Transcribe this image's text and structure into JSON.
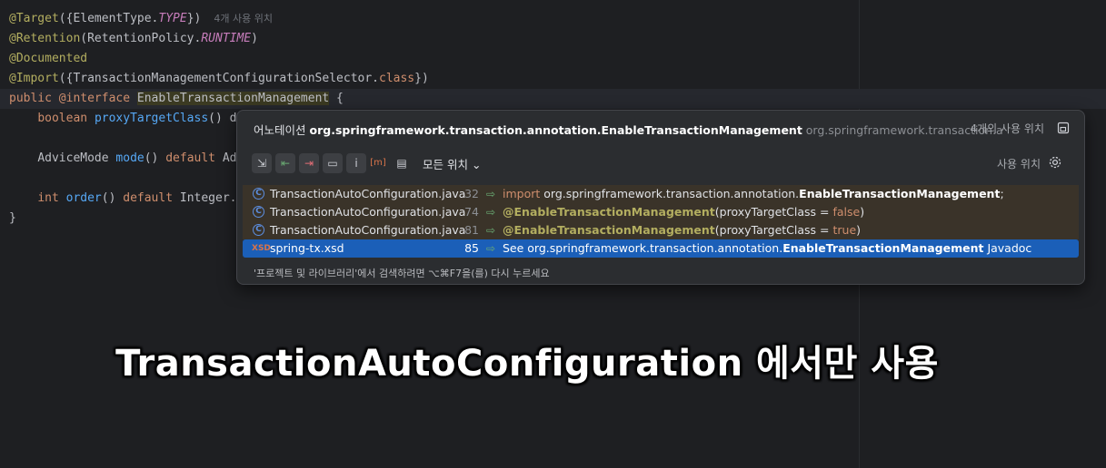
{
  "code": {
    "line1": {
      "anno": "@Target",
      "body": "({ElementType.",
      "const": "TYPE",
      "end": "})",
      "hint": "4개 사용 위치"
    },
    "line2": {
      "anno": "@Retention",
      "body": "(RetentionPolicy.",
      "const": "RUNTIME",
      "end": ")"
    },
    "line3": {
      "anno": "@Documented"
    },
    "line4": {
      "anno": "@Import",
      "body": "({TransactionManagementConfigurationSelector.",
      "kw": "class",
      "end": "})"
    },
    "line5": {
      "kw1": "public",
      "kw2": "@interface",
      "name": "EnableTransactionManagement",
      "end": " {"
    },
    "line6": {
      "kw": "boolean",
      "fn": "proxyTargetClass",
      "rest": "() d"
    },
    "line7": {
      "type": "AdviceMode",
      "fn": "mode",
      "rest": "() ",
      "kw": "default",
      "tail": " Ad"
    },
    "line8": {
      "kw": "int",
      "fn": "order",
      "rest": "() ",
      "kw2": "default",
      "tail": " Integer."
    },
    "line9": {
      "text": "}"
    }
  },
  "popup": {
    "title_prefix": "어노테이션",
    "title_fq": "org.springframework.transaction.annotation.EnableTransactionManagement",
    "title_pkg": "org.springframework.transaction.a",
    "count": "4개의 사용 위치",
    "scope": "모든 위치",
    "usage_label": "사용 위치",
    "rows": [
      {
        "file": "TransactionAutoConfiguration.java",
        "line": "32",
        "p1": "import",
        "p2": " org.springframework.transaction.annotation.",
        "p3": "EnableTransactionManagement",
        "p4": ";"
      },
      {
        "file": "TransactionAutoConfiguration.java",
        "line": "74",
        "p1": "@EnableTransactionManagement",
        "p2": "(proxyTargetClass = ",
        "p3": "false",
        "p4": ")"
      },
      {
        "file": "TransactionAutoConfiguration.java",
        "line": "81",
        "p1": "@EnableTransactionManagement",
        "p2": "(proxyTargetClass = ",
        "p3": "true",
        "p4": ")"
      },
      {
        "icon": "XSD",
        "file": "spring-tx.xsd",
        "line": "85",
        "p1": "See org.springframework.transaction.annotation.",
        "p2": "EnableTransactionManagement",
        "p3": " Javadoc"
      }
    ],
    "footer": "'프로젝트 및 라이브러리'에서 검색하려면 ⌥⌘F7을(를) 다시 누르세요"
  },
  "caption": "TransactionAutoConfiguration 에서만 사용",
  "colors": {
    "background": "#1e1f22",
    "popup": "#2b2d30",
    "selection": "#1b5fb8",
    "annotation": "#b3ae60",
    "keyword": "#cf8e6d"
  }
}
